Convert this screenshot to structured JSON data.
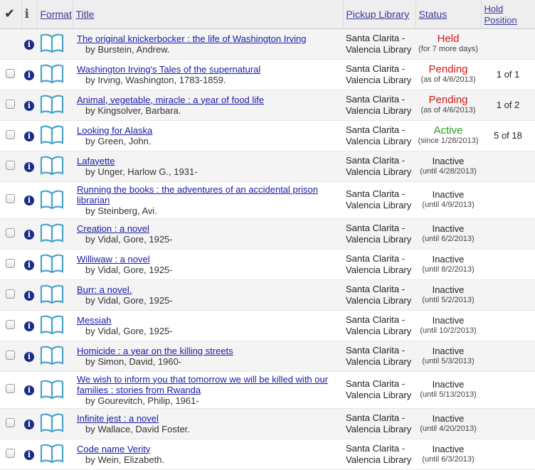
{
  "header": {
    "check": "✔",
    "info": "i",
    "format": "Format",
    "title": "Title",
    "pickup": "Pickup Library",
    "status": "Status",
    "hold_line1": "Hold",
    "hold_line2": "Position"
  },
  "holds": [
    {
      "title": "The original knickerbocker : the life of Washington Irving",
      "author": "by Burstein, Andrew.",
      "lib1": "Santa Clarita -",
      "lib2": "Valencia Library",
      "status": "Held",
      "status_sub": "(for 7 more days)",
      "position": "",
      "checkbox": false
    },
    {
      "title": "Washington Irving's Tales of the supernatural",
      "author": "by Irving, Washington, 1783-1859.",
      "lib1": "Santa Clarita -",
      "lib2": "Valencia Library",
      "status": "Pending",
      "status_sub": "(as of 4/6/2013)",
      "position": "1 of 1",
      "checkbox": true
    },
    {
      "title": "Animal, vegetable, miracle : a year of food life",
      "author": "by Kingsolver, Barbara.",
      "lib1": "Santa Clarita -",
      "lib2": "Valencia Library",
      "status": "Pending",
      "status_sub": "(as of 4/6/2013)",
      "position": "1 of 2",
      "checkbox": true
    },
    {
      "title": "Looking for Alaska",
      "author": "by Green, John.",
      "lib1": "Santa Clarita -",
      "lib2": "Valencia Library",
      "status": "Active",
      "status_sub": "(since 1/28/2013)",
      "position": "5 of 18",
      "checkbox": true
    },
    {
      "title": "Lafayette",
      "author": "by Unger, Harlow G., 1931-",
      "lib1": "Santa Clarita -",
      "lib2": "Valencia Library",
      "status": "Inactive",
      "status_sub": "(until 4/28/2013)",
      "position": "",
      "checkbox": true
    },
    {
      "title": "Running the books : the adventures of an accidental prison librarian",
      "author": "by Steinberg, Avi.",
      "lib1": "Santa Clarita -",
      "lib2": "Valencia Library",
      "status": "Inactive",
      "status_sub": "(until 4/9/2013)",
      "position": "",
      "checkbox": true
    },
    {
      "title": "Creation : a novel",
      "author": "by Vidal, Gore, 1925-",
      "lib1": "Santa Clarita -",
      "lib2": "Valencia Library",
      "status": "Inactive",
      "status_sub": "(until 6/2/2013)",
      "position": "",
      "checkbox": true
    },
    {
      "title": "Williwaw : a novel",
      "author": "by Vidal, Gore, 1925-",
      "lib1": "Santa Clarita -",
      "lib2": "Valencia Library",
      "status": "Inactive",
      "status_sub": "(until 8/2/2013)",
      "position": "",
      "checkbox": true
    },
    {
      "title": "Burr: a novel.",
      "author": "by Vidal, Gore, 1925-",
      "lib1": "Santa Clarita -",
      "lib2": "Valencia Library",
      "status": "Inactive",
      "status_sub": "(until 5/2/2013)",
      "position": "",
      "checkbox": true
    },
    {
      "title": "Messiah",
      "author": "by Vidal, Gore, 1925-",
      "lib1": "Santa Clarita -",
      "lib2": "Valencia Library",
      "status": "Inactive",
      "status_sub": "(until 10/2/2013)",
      "position": "",
      "checkbox": true
    },
    {
      "title": "Homicide : a year on the killing streets",
      "author": "by Simon, David, 1960-",
      "lib1": "Santa Clarita -",
      "lib2": "Valencia Library",
      "status": "Inactive",
      "status_sub": "(until 5/3/2013)",
      "position": "",
      "checkbox": true
    },
    {
      "title": "We wish to inform you that tomorrow we will be killed with our families : stories from Rwanda",
      "author": "by Gourevitch, Philip, 1961-",
      "lib1": "Santa Clarita -",
      "lib2": "Valencia Library",
      "status": "Inactive",
      "status_sub": "(until 5/13/2013)",
      "position": "",
      "checkbox": true
    },
    {
      "title": "Infinite jest : a novel",
      "author": "by Wallace, David Foster.",
      "lib1": "Santa Clarita -",
      "lib2": "Valencia Library",
      "status": "Inactive",
      "status_sub": "(until 4/20/2013)",
      "position": "",
      "checkbox": true
    },
    {
      "title": "Code name Verity",
      "author": "by Wein, Elizabeth.",
      "lib1": "Santa Clarita -",
      "lib2": "Valencia Library",
      "status": "Inactive",
      "status_sub": "(until 6/3/2013)",
      "position": "",
      "checkbox": true
    }
  ],
  "icons": {
    "info": "info-icon",
    "format": "book-icon"
  },
  "colors": {
    "link": "#1a1aa6",
    "held": "#d21919",
    "pending": "#d21919",
    "active": "#2b9a1e",
    "info_icon": "#1b2b8a",
    "book_icon": "#4aa3c9"
  }
}
